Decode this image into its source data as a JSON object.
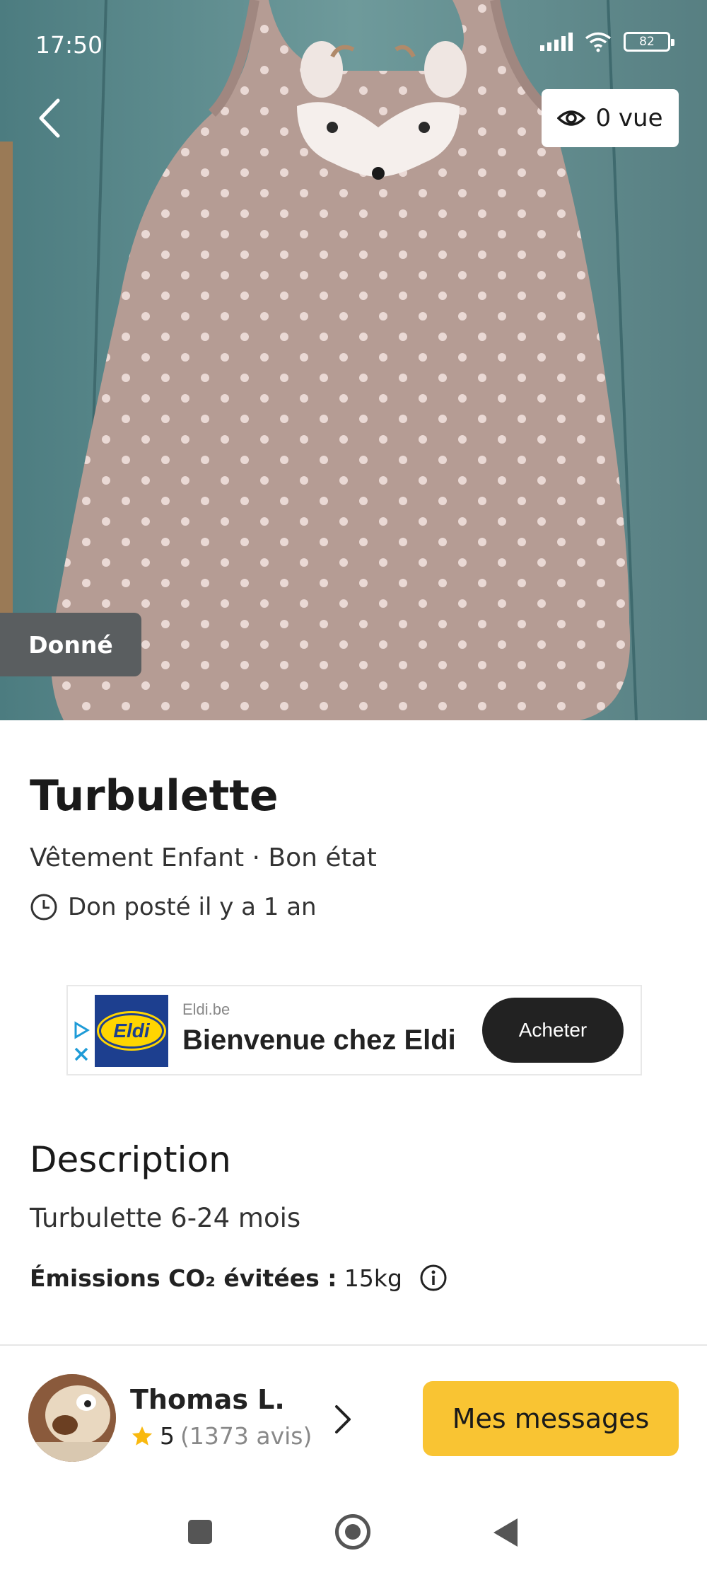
{
  "status_bar": {
    "time": "17:50",
    "battery": "82"
  },
  "header": {
    "views_label": "0 vue"
  },
  "listing": {
    "badge": "Donné",
    "title": "Turbulette",
    "meta": "Vêtement Enfant · Bon état",
    "posted": "Don posté il y a 1 an"
  },
  "ad": {
    "domain": "Eldi.be",
    "headline": "Bienvenue chez Eldi",
    "logo_text": "Eldi",
    "cta": "Acheter"
  },
  "description": {
    "heading": "Description",
    "text": "Turbulette 6-24 mois",
    "co2_label": "Émissions CO₂ évitées :",
    "co2_value": "15kg"
  },
  "seller": {
    "name": "Thomas L.",
    "score": "5",
    "reviews": "(1373 avis)"
  },
  "actions": {
    "messages": "Mes messages"
  },
  "colors": {
    "accent": "#f9c433",
    "badge": "#5a5e60",
    "ad_blue": "#1d3f8f",
    "ad_yellow": "#ffd500"
  }
}
